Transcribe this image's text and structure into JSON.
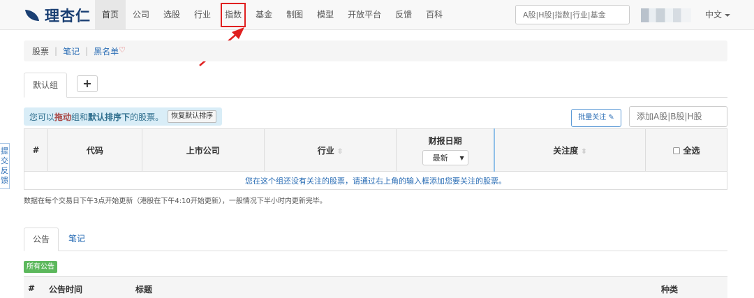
{
  "brand": {
    "name": "理杏仁"
  },
  "nav": {
    "items": [
      {
        "label": "首页",
        "active": true
      },
      {
        "label": "公司"
      },
      {
        "label": "选股"
      },
      {
        "label": "行业"
      },
      {
        "label": "指数",
        "highlighted": true
      },
      {
        "label": "基金"
      },
      {
        "label": "制图"
      },
      {
        "label": "模型"
      },
      {
        "label": "开放平台"
      },
      {
        "label": "反馈"
      },
      {
        "label": "百科"
      }
    ],
    "search_placeholder": "A股|H股|指数|行业|基金",
    "language": "中文"
  },
  "side_feedback": {
    "label": "提交反馈"
  },
  "breadcrumb": {
    "items": [
      "股票",
      "笔记",
      "黑名单"
    ]
  },
  "groups": {
    "default_tab": "默认组",
    "add_label": "+"
  },
  "hint": {
    "prefix": "您可以",
    "drag": "拖动",
    "mid": "组和",
    "sort": "默认排序下",
    "suffix": "的股票。",
    "restore_button": "恢复默认排序"
  },
  "actions": {
    "batch_follow": "批量关注",
    "add_stock_placeholder": "添加A股|B股|H股"
  },
  "table": {
    "headers": {
      "index": "#",
      "code": "代码",
      "company": "上市公司",
      "industry": "行业",
      "report_date": "财报日期",
      "attention": "关注度",
      "select_all": "全选"
    },
    "date_select_value": "最新",
    "empty_message": "您在这个组还没有关注的股票，请通过右上角的输入框添加您要关注的股票。"
  },
  "update_note": "数据在每个交易日下午3点开始更新（港股在下午4:10开始更新），一般情况下半小时内更新完毕。",
  "announcements": {
    "tabs": [
      "公告",
      "笔记"
    ],
    "filter_label": "所有公告",
    "columns": {
      "index": "#",
      "time": "公告时间",
      "title": "标题",
      "type": "种类"
    }
  },
  "colors": {
    "brand": "#1a3f73",
    "link": "#2a6db5",
    "highlight_box": "#e02020",
    "label_green": "#5cb85c",
    "hint_bg": "#d9edf7"
  }
}
